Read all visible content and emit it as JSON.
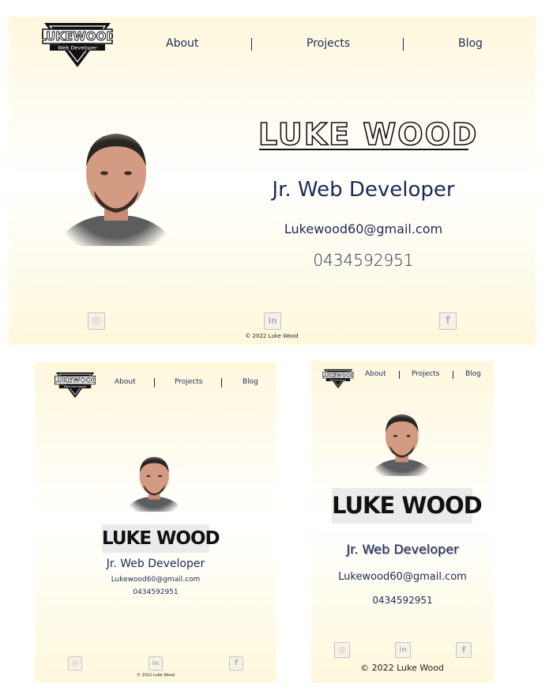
{
  "brand": {
    "name": "LUKEWOOD",
    "tagline": "Web Developer"
  },
  "nav": {
    "about": "About",
    "projects": "Projects",
    "blog": "Blog"
  },
  "profile": {
    "name": "LUKE WOOD",
    "title": "Jr. Web Developer",
    "email": "Lukewood60@gmail.com",
    "phone": "0434592951"
  },
  "socials": [
    {
      "icon": "instagram-icon",
      "glyph": "◎"
    },
    {
      "icon": "linkedin-icon",
      "glyph": "in"
    },
    {
      "icon": "facebook-icon",
      "glyph": "f"
    }
  ],
  "footer": {
    "copyright": "© 2022 Luke Wood",
    "copyright_large": "© 2022 Luke Wood"
  },
  "colors": {
    "navy": "#1d2a55",
    "cream": "#fff8de",
    "name_box": "#ebebeb"
  }
}
